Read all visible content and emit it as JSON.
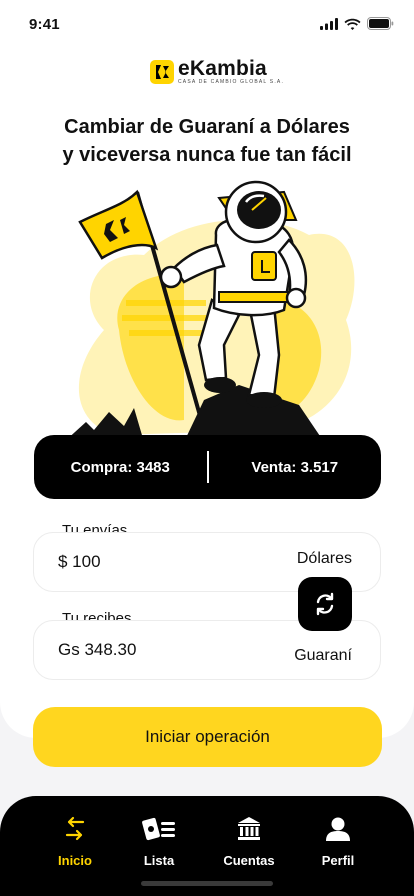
{
  "status_bar": {
    "time": "9:41"
  },
  "brand": {
    "name": "eKambia",
    "tagline": "CASA DE CAMBIO GLOBAL S.A."
  },
  "headline": {
    "line1": "Cambiar de Guaraní a Dólares",
    "line2": "y viceversa nunca fue tan fácil"
  },
  "rates": {
    "buy": "Compra: 3483",
    "sell": "Venta: 3.517"
  },
  "send": {
    "label": "Tu envías",
    "value": "$ 100",
    "currency": "Dólares"
  },
  "receive": {
    "label": "Tu recibes",
    "value": "Gs 348.30",
    "currency": "Guaraní"
  },
  "actions": {
    "start": "Iniciar operación"
  },
  "nav": {
    "items": [
      {
        "label": "Inicio",
        "icon": "swap-arrows-icon",
        "active": true
      },
      {
        "label": "Lista",
        "icon": "list-icon",
        "active": false
      },
      {
        "label": "Cuentas",
        "icon": "bank-icon",
        "active": false
      },
      {
        "label": "Perfil",
        "icon": "person-icon",
        "active": false
      }
    ]
  },
  "colors": {
    "accent": "#FFD400",
    "dark": "#000000",
    "background": "#f4f4f6"
  }
}
